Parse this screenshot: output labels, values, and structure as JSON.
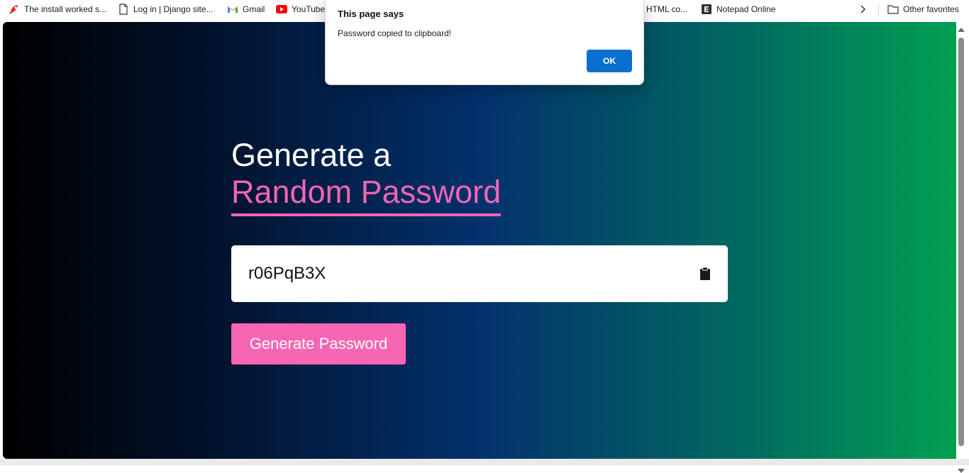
{
  "favorites": [
    {
      "label": "The install worked s...",
      "icon": "rocket-icon"
    },
    {
      "label": "Log in | Django site...",
      "icon": "page-icon"
    },
    {
      "label": "Gmail",
      "icon": "gmail-icon"
    },
    {
      "label": "YouTube",
      "icon": "youtube-icon"
    },
    {
      "label": "HTML co...",
      "icon": "page-icon"
    },
    {
      "label": "Notepad Online",
      "icon": "e-letter-icon"
    }
  ],
  "favorites_more_icon": "chevron-right-icon",
  "other_favorites": {
    "label": "Other favorites",
    "icon": "folder-icon"
  },
  "heading": {
    "line1": "Generate a",
    "line2": "Random Password"
  },
  "password": {
    "value": "r06PqB3X",
    "copy_icon": "clipboard-icon"
  },
  "generate_button": {
    "label": "Generate Password"
  },
  "dialog": {
    "title": "This page says",
    "message": "Password copied to clipboard!",
    "ok_label": "OK"
  },
  "colors": {
    "accent_pink": "#f065b4",
    "button_pink": "#f766b3",
    "dialog_ok_blue": "#0a6fd1",
    "gradient": [
      "#000000",
      "#011028",
      "#03316d",
      "#016462",
      "#019f52"
    ]
  }
}
